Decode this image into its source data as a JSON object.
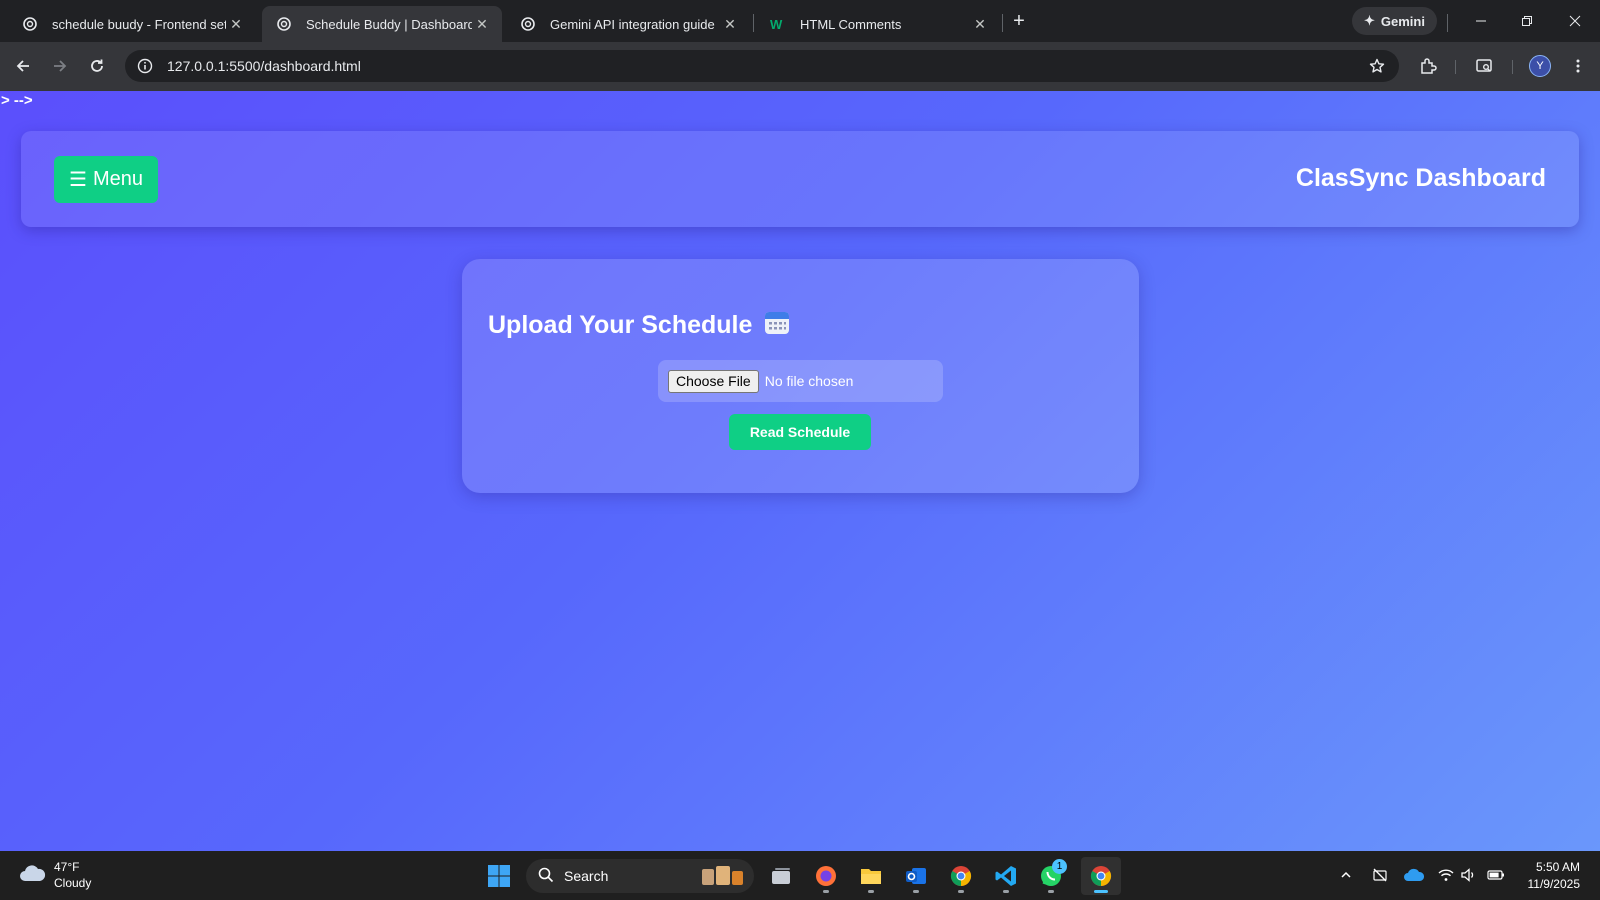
{
  "browser": {
    "tabs": [
      {
        "title": "schedule buudy - Frontend setu",
        "icon": "chatgpt-icon",
        "active": false
      },
      {
        "title": "Schedule Buddy | Dashboard",
        "icon": "globe-icon",
        "active": true
      },
      {
        "title": "Gemini API integration guide",
        "icon": "chatgpt-icon",
        "active": false
      },
      {
        "title": "HTML Comments",
        "icon": "w3schools-icon",
        "active": false
      }
    ],
    "gemini_label": "Gemini",
    "url": "127.0.0.1:5500/dashboard.html",
    "profile_initial": "Y"
  },
  "page": {
    "stray_text": "> -->",
    "menu_label": "Menu",
    "dashboard_title": "ClasSync Dashboard",
    "card_title": "Upload Your Schedule",
    "choose_file_label": "Choose File",
    "no_file_label": "No file chosen",
    "read_button_label": "Read Schedule"
  },
  "taskbar": {
    "weather_temp": "47°F",
    "weather_desc": "Cloudy",
    "search_label": "Search",
    "whatsapp_badge": "1",
    "time": "5:50 AM",
    "date": "11/9/2025"
  },
  "colors": {
    "accent_green": "#0fcf85",
    "gradient_start": "#5b4ffc",
    "gradient_end": "#6a97fb",
    "chrome_dark": "#202124"
  }
}
